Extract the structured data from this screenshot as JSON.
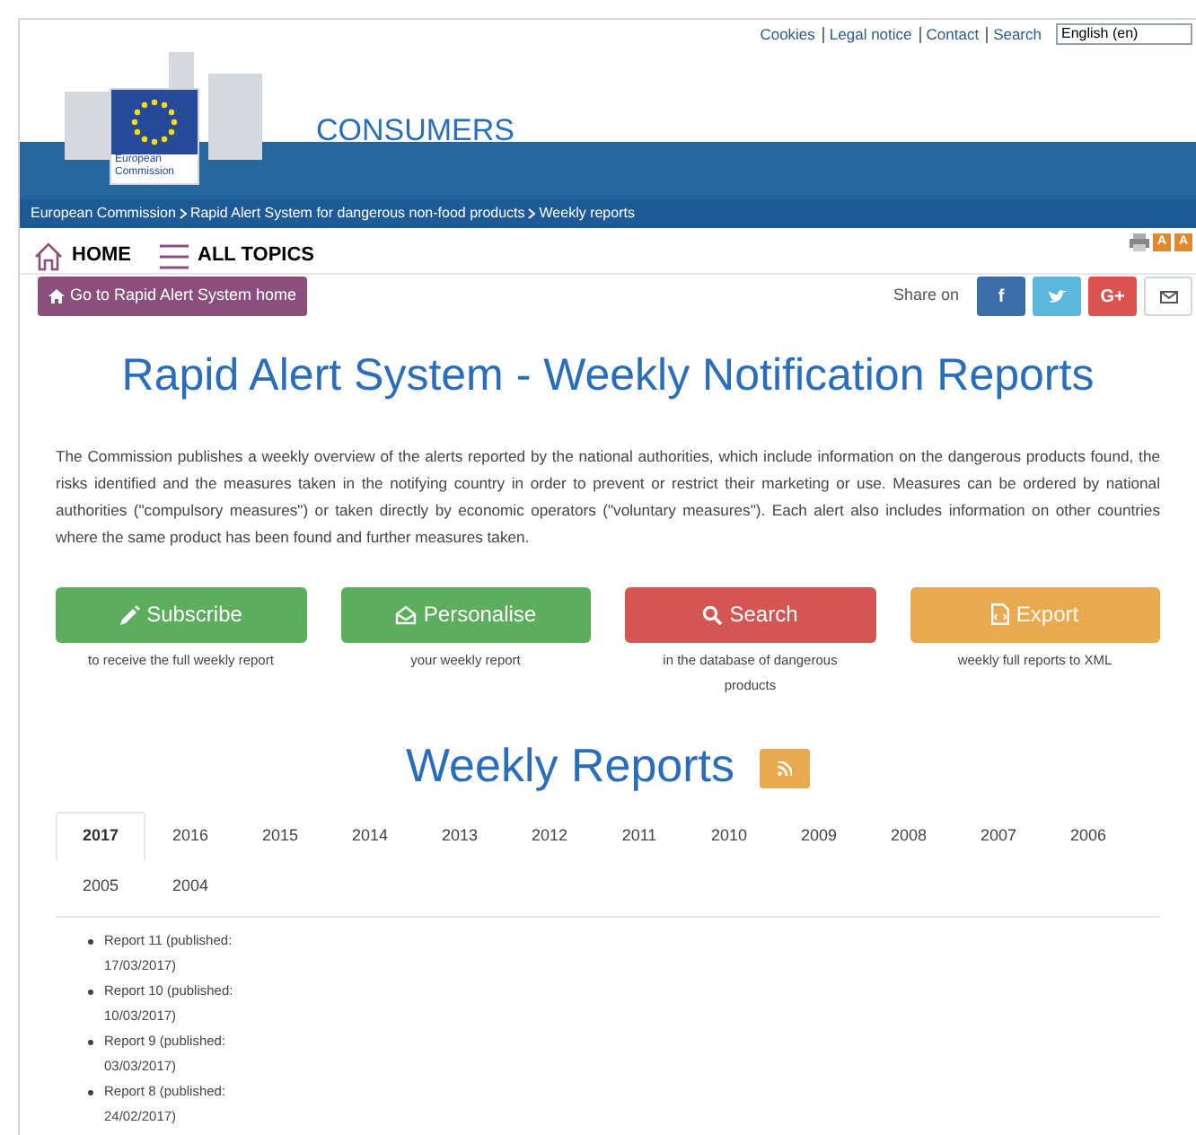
{
  "top_links": [
    "Cookies",
    "Legal notice",
    "Contact",
    "Search"
  ],
  "language": {
    "value": "English (en)"
  },
  "logo": {
    "line1": "European",
    "line2": "Commission"
  },
  "site_title": "CONSUMERS",
  "breadcrumb": [
    "European Commission",
    "Rapid Alert System for dangerous non-food products",
    "Weekly reports"
  ],
  "nav": [
    {
      "label": "HOME",
      "kind": "home"
    },
    {
      "label": "ALL TOPICS",
      "kind": "menu"
    }
  ],
  "tools": [
    {
      "kind": "print"
    },
    {
      "kind": "font",
      "label": "A"
    },
    {
      "kind": "font",
      "label": "A"
    }
  ],
  "home_button": "Go to Rapid Alert System home",
  "share": {
    "label": "Share on",
    "buttons": [
      {
        "kind": "facebook",
        "label": "f",
        "color": "#3b6ea8"
      },
      {
        "kind": "twitter",
        "color": "#5bb7db"
      },
      {
        "kind": "google",
        "label": "G+",
        "color": "#d9534f"
      },
      {
        "kind": "email",
        "color": "#ffffff"
      }
    ]
  },
  "title": "Rapid Alert System - Weekly Notification Reports",
  "intro": "The Commission publishes a weekly overview of the alerts reported by the national authorities, which include information on the dangerous products found, the risks identified and the measures taken in the notifying country in order to prevent or restrict their marketing or use. Measures can be ordered by national authorities (\"compulsory measures\") or taken directly by economic operators (\"voluntary measures\"). Each alert also includes information on other countries where the same product has been found and further measures taken.",
  "actions": [
    {
      "kind": "subscribe",
      "label": "Subscribe",
      "caption": "to receive the full weekly report",
      "color": "#5cad5c"
    },
    {
      "kind": "personalise",
      "label": "Personalise",
      "caption": "your weekly report",
      "color": "#5cad5c"
    },
    {
      "kind": "search",
      "label": "Search",
      "caption": "in the database of dangerous products",
      "color": "#d45551"
    },
    {
      "kind": "export",
      "label": "Export",
      "caption": "weekly full reports to XML",
      "color": "#e9a94e"
    }
  ],
  "reports_heading": "Weekly Reports",
  "year_tabs": [
    {
      "label": "2017",
      "selected": true
    },
    {
      "label": "2016",
      "selected": false
    },
    {
      "label": "2015",
      "selected": false
    },
    {
      "label": "2014",
      "selected": false
    },
    {
      "label": "2013",
      "selected": false
    },
    {
      "label": "2012",
      "selected": false
    },
    {
      "label": "2011",
      "selected": false
    },
    {
      "label": "2010",
      "selected": false
    },
    {
      "label": "2009",
      "selected": false
    },
    {
      "label": "2008",
      "selected": false
    },
    {
      "label": "2007",
      "selected": false
    },
    {
      "label": "2006",
      "selected": false
    },
    {
      "label": "2005",
      "selected": false
    },
    {
      "label": "2004",
      "selected": false
    }
  ],
  "reports": [
    "Report 11 (published: 17/03/2017)",
    "Report 10 (published: 10/03/2017)",
    "Report 9 (published: 03/03/2017)",
    "Report 8 (published: 24/02/2017)"
  ]
}
